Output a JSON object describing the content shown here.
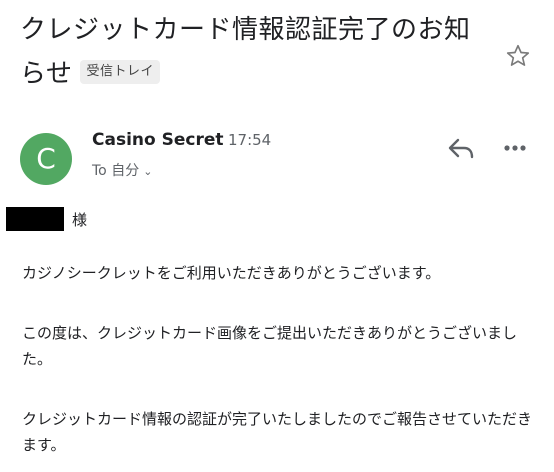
{
  "email": {
    "subject": "クレジットカード情報認証完了のお知らせ",
    "label": "受信トレイ",
    "sender": {
      "initial": "C",
      "name": "Casino Secret",
      "time": "17:54",
      "recipient": "To 自分",
      "avatar_color": "#52a862"
    },
    "salutation": "様",
    "paragraphs": [
      "カジノシークレットをご利用いただきありがとうございます。",
      "この度は、クレジットカード画像をご提出いただきありがとうございました。",
      "クレジットカード情報の認証が完了いたしましたのでご報告させていただきます。"
    ]
  },
  "icons": {
    "star": "star-icon",
    "reply": "reply-icon",
    "more": "more-options-icon",
    "chevron": "chevron-down-icon"
  }
}
